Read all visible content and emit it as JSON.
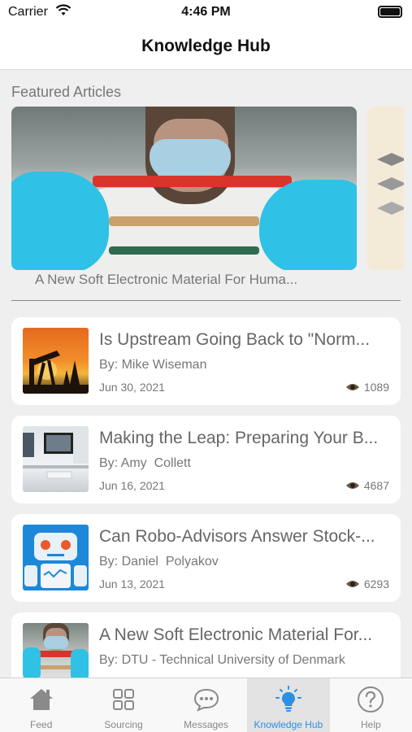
{
  "status_bar": {
    "carrier": "Carrier",
    "time": "4:46 PM"
  },
  "nav": {
    "title": "Knowledge Hub"
  },
  "featured": {
    "section_title": "Featured Articles",
    "items": [
      {
        "caption": "A New Soft Electronic Material For Huma..."
      }
    ]
  },
  "articles": [
    {
      "title": "Is Upstream Going Back to \"Norm...",
      "author": "By: Mike Wiseman",
      "date": "Jun 30, 2021",
      "views": "1089",
      "thumb": "oil-pump-image"
    },
    {
      "title": "Making the Leap: Preparing Your B...",
      "author": "By: Amy  Collett",
      "date": "Jun 16, 2021",
      "views": "4687",
      "thumb": "office-desk-image"
    },
    {
      "title": "Can Robo-Advisors Answer Stock-...",
      "author": "By: Daniel  Polyakov",
      "date": "Jun 13, 2021",
      "views": "6293",
      "thumb": "robot-image"
    },
    {
      "title": "A New Soft Electronic Material For...",
      "author": "By: DTU - Technical University of Denmark",
      "date": "",
      "views": "",
      "thumb": "scientist-image"
    }
  ],
  "tabs": [
    {
      "label": "Feed",
      "icon": "home-icon",
      "active": false
    },
    {
      "label": "Sourcing",
      "icon": "grid-icon",
      "active": false
    },
    {
      "label": "Messages",
      "icon": "chat-bubble-icon",
      "active": false
    },
    {
      "label": "Knowledge Hub",
      "icon": "lightbulb-icon",
      "active": true
    },
    {
      "label": "Help",
      "icon": "question-circle-icon",
      "active": false
    }
  ],
  "colors": {
    "accent": "#2b8fe6",
    "background": "#efefef",
    "card": "#ffffff"
  }
}
